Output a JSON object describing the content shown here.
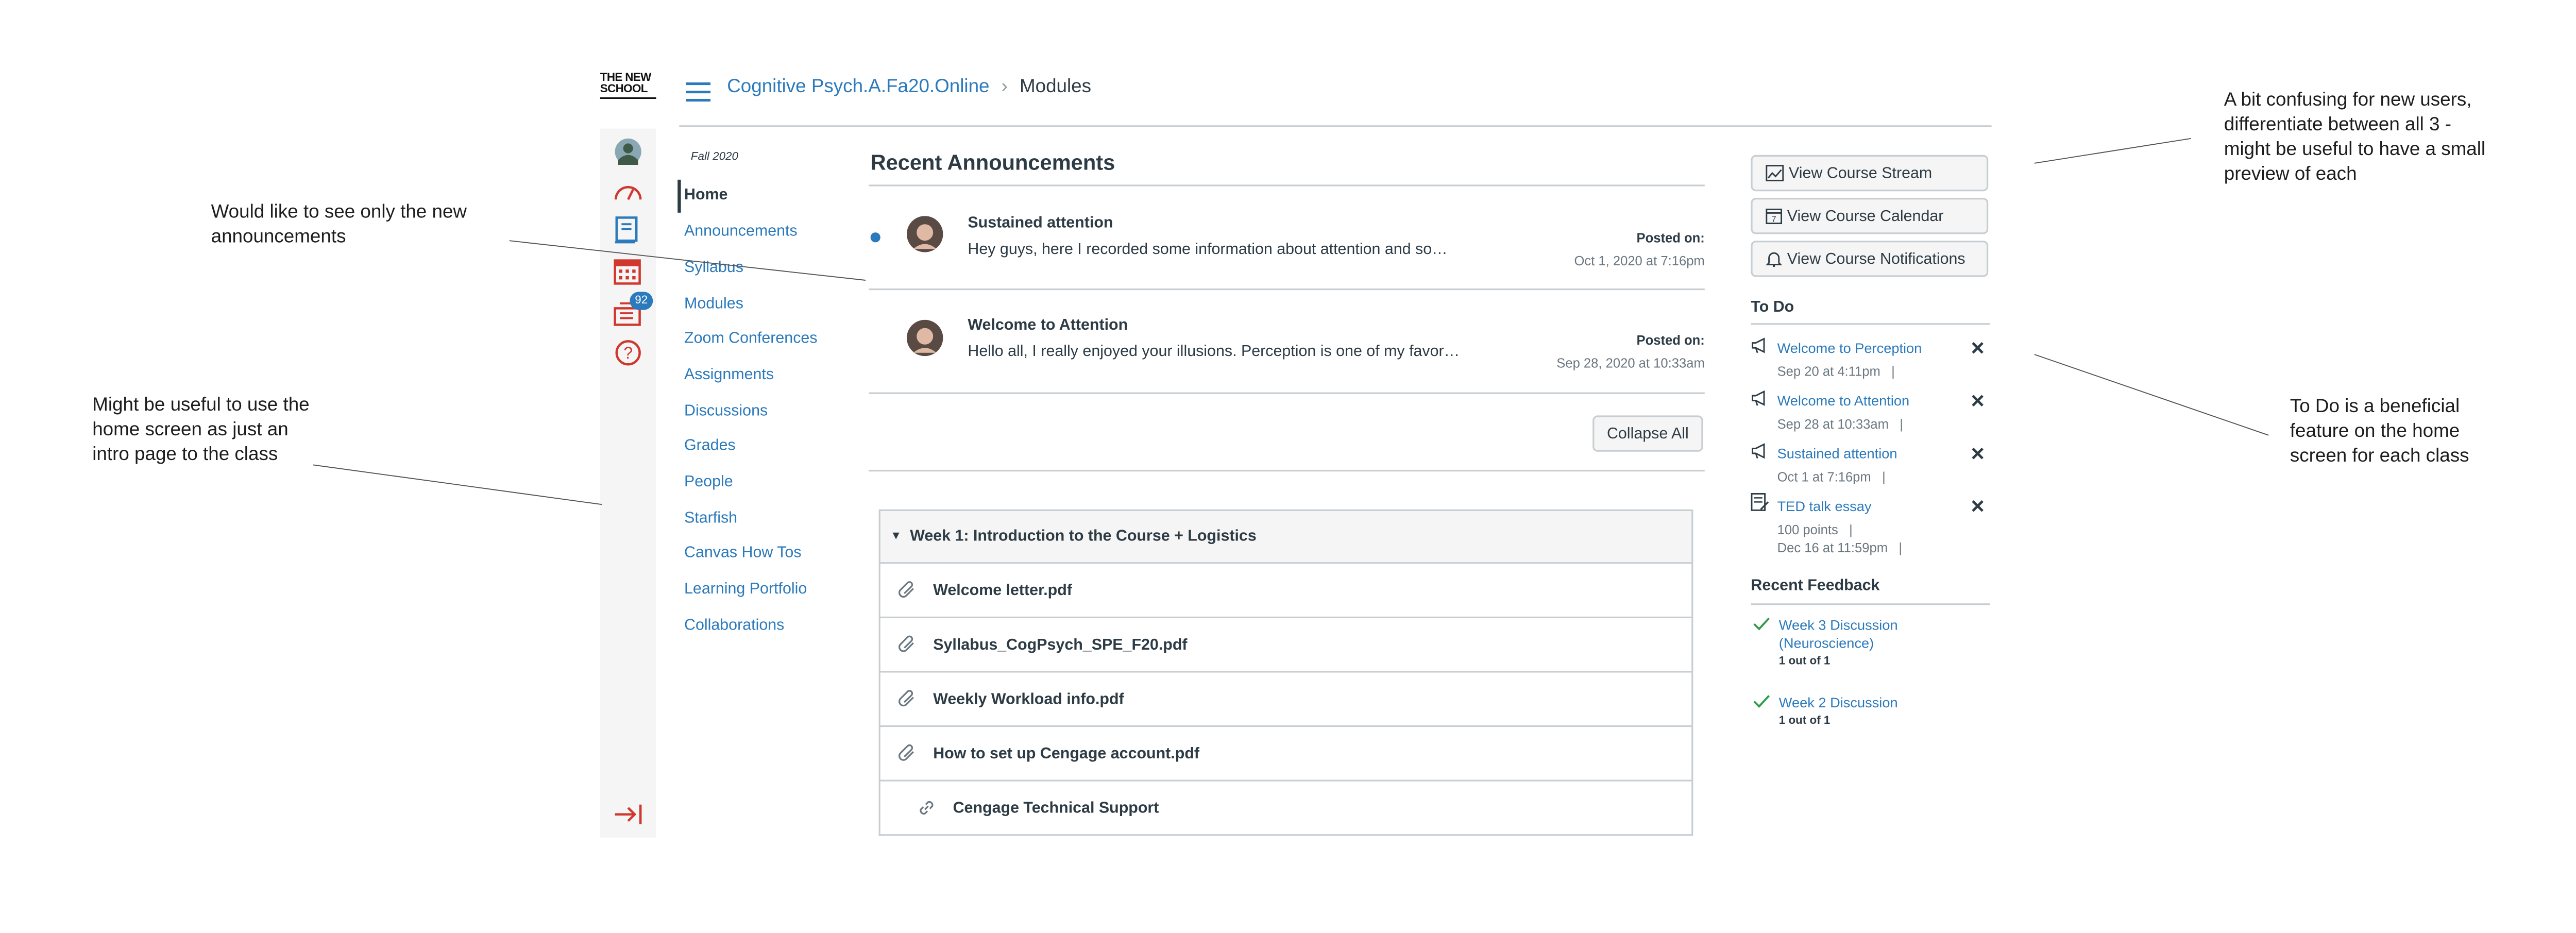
{
  "header": {
    "logo": "THE NEW SCHOOL",
    "breadcrumb_course": "Cognitive Psych.A.Fa20.Online",
    "breadcrumb_separator": "›",
    "breadcrumb_current": "Modules"
  },
  "global_nav": {
    "badge": "92",
    "icons": [
      "avatar-icon",
      "dashboard-icon",
      "courses-icon",
      "calendar-icon",
      "inbox-icon",
      "help-icon",
      "collapse-icon"
    ]
  },
  "course_nav": {
    "term": "Fall 2020",
    "items": [
      {
        "label": "Home"
      },
      {
        "label": "Announcements"
      },
      {
        "label": "Syllabus"
      },
      {
        "label": "Modules"
      },
      {
        "label": "Zoom Conferences"
      },
      {
        "label": "Assignments"
      },
      {
        "label": "Discussions"
      },
      {
        "label": "Grades"
      },
      {
        "label": "People"
      },
      {
        "label": "Starfish"
      },
      {
        "label": "Canvas How Tos"
      },
      {
        "label": "Learning Portfolio"
      },
      {
        "label": "Collaborations"
      }
    ]
  },
  "announcements": {
    "heading": "Recent Announcements",
    "posted_label": "Posted on:",
    "items": [
      {
        "title": "Sustained attention",
        "preview": "Hey guys, here I recorded some information about attention and so…",
        "date": "Oct 1, 2020 at 7:16pm",
        "unread": true
      },
      {
        "title": "Welcome to Attention",
        "preview": "Hello all, I really enjoyed your illusions. Perception is one of my favor…",
        "date": "Sep 28, 2020 at 10:33am",
        "unread": false
      }
    ],
    "collapse_label": "Collapse All"
  },
  "module": {
    "title": "Week 1: Introduction to the Course + Logistics",
    "items": [
      {
        "label": "Welcome letter.pdf",
        "icon": "paperclip-icon"
      },
      {
        "label": "Syllabus_CogPsych_SPE_F20.pdf",
        "icon": "paperclip-icon"
      },
      {
        "label": "Weekly Workload info.pdf",
        "icon": "paperclip-icon"
      },
      {
        "label": "How to set up Cengage account.pdf",
        "icon": "paperclip-icon"
      },
      {
        "label": "Cengage Technical Support",
        "icon": "link-icon"
      }
    ]
  },
  "sidebar": {
    "buttons": [
      {
        "label": "View Course Stream",
        "icon": "stream-icon"
      },
      {
        "label": "View Course Calendar",
        "icon": "calendar-icon"
      },
      {
        "label": "View Course Notifications",
        "icon": "bell-icon"
      }
    ],
    "todo_heading": "To Do",
    "todo": [
      {
        "title": "Welcome to Perception",
        "sub1": "Sep 20 at 4:11pm   |",
        "sub2": "",
        "icon": "megaphone-icon"
      },
      {
        "title": "Welcome to Attention",
        "sub1": "Sep 28 at 10:33am   |",
        "sub2": "",
        "icon": "megaphone-icon"
      },
      {
        "title": "Sustained attention",
        "sub1": "Oct 1 at 7:16pm   |",
        "sub2": "",
        "icon": "megaphone-icon"
      },
      {
        "title": "TED talk essay",
        "sub1": "100 points   |",
        "sub2": "Dec 16 at 11:59pm   |",
        "icon": "assignment-icon"
      }
    ],
    "close_glyph": "✕",
    "feedback_heading": "Recent Feedback",
    "feedback": [
      {
        "title": "Week 3 Discussion (Neuroscience)",
        "score": "1 out of 1"
      },
      {
        "title": "Week 2 Discussion",
        "score": "1 out of 1"
      }
    ]
  },
  "annotations": [
    {
      "text": "Would like to see only the new\nannouncements"
    },
    {
      "text": "Might be useful to use the\nhome screen as just an\nintro page to the class"
    },
    {
      "text": "A bit confusing for new users,\ndifferentiate between all 3 -\nmight be useful to have a small\npreview of each"
    },
    {
      "text": "To Do is a beneficial\nfeature on the home\nscreen for each class"
    }
  ],
  "colors": {
    "link": "#2b7abc",
    "brand_red": "#d0372d",
    "badge": "#2b7abc",
    "border": "#c7cdd1"
  }
}
